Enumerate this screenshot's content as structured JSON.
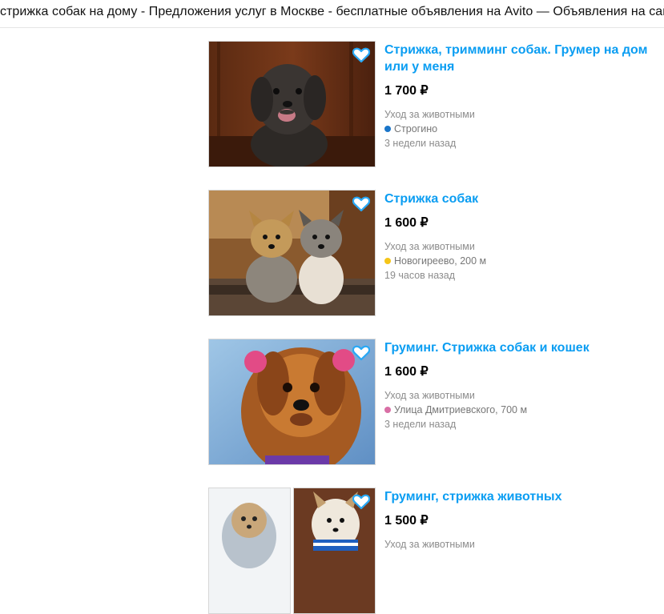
{
  "window": {
    "title": "стрижка собак на дому - Предложения услуг в Москве - бесплатные объявления на Avito — Объявления на сайте Авито"
  },
  "listings": [
    {
      "title": "Стрижка, тримминг собак. Грумер на дом или у меня",
      "price": "1 700 ₽",
      "category": "Уход за животными",
      "location": "Строгино",
      "metro_color": "#1a75c9",
      "time": "3 недели назад",
      "favorite_icon": "heart-outline-icon"
    },
    {
      "title": "Стрижка собак",
      "price": "1 600 ₽",
      "category": "Уход за животными",
      "location": "Новогиреево, 200 м",
      "metro_color": "#f5c518",
      "time": "19 часов назад",
      "favorite_icon": "heart-outline-icon"
    },
    {
      "title": "Груминг. Стрижка собак и кошек",
      "price": "1 600 ₽",
      "category": "Уход за животными",
      "location": "Улица Дмитриевского, 700 м",
      "metro_color": "#d96fa5",
      "time": "3 недели назад",
      "favorite_icon": "heart-outline-icon"
    },
    {
      "title": "Груминг, стрижка животных",
      "price": "1 500 ₽",
      "category": "Уход за животными",
      "favorite_icon": "heart-outline-icon"
    }
  ]
}
